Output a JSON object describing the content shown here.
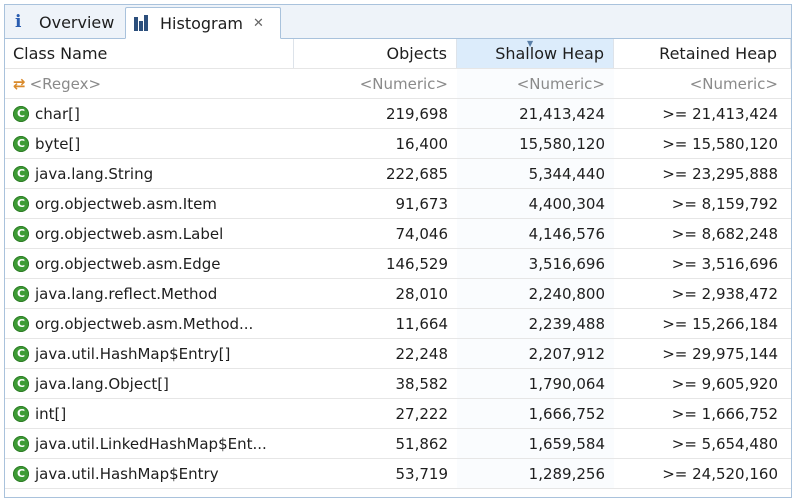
{
  "tabs": [
    {
      "label": "Overview",
      "icon": "info-icon"
    },
    {
      "label": "Histogram",
      "icon": "histogram-icon",
      "active": true
    }
  ],
  "columns": [
    "Class Name",
    "Objects",
    "Shallow Heap",
    "Retained Heap"
  ],
  "filters": {
    "class_name": "<Regex>",
    "objects": "<Numeric>",
    "shallow": "<Numeric>",
    "retained": "<Numeric>"
  },
  "rows": [
    {
      "name": "char[]",
      "objects": "219,698",
      "shallow": "21,413,424",
      "retained": ">= 21,413,424"
    },
    {
      "name": "byte[]",
      "objects": "16,400",
      "shallow": "15,580,120",
      "retained": ">= 15,580,120"
    },
    {
      "name": "java.lang.String",
      "objects": "222,685",
      "shallow": "5,344,440",
      "retained": ">= 23,295,888"
    },
    {
      "name": "org.objectweb.asm.Item",
      "objects": "91,673",
      "shallow": "4,400,304",
      "retained": ">= 8,159,792"
    },
    {
      "name": "org.objectweb.asm.Label",
      "objects": "74,046",
      "shallow": "4,146,576",
      "retained": ">= 8,682,248"
    },
    {
      "name": "org.objectweb.asm.Edge",
      "objects": "146,529",
      "shallow": "3,516,696",
      "retained": ">= 3,516,696"
    },
    {
      "name": "java.lang.reflect.Method",
      "objects": "28,010",
      "shallow": "2,240,800",
      "retained": ">= 2,938,472"
    },
    {
      "name": "org.objectweb.asm.Method...",
      "objects": "11,664",
      "shallow": "2,239,488",
      "retained": ">= 15,266,184"
    },
    {
      "name": "java.util.HashMap$Entry[]",
      "objects": "22,248",
      "shallow": "2,207,912",
      "retained": ">= 29,975,144"
    },
    {
      "name": "java.lang.Object[]",
      "objects": "38,582",
      "shallow": "1,790,064",
      "retained": ">= 9,605,920"
    },
    {
      "name": "int[]",
      "objects": "27,222",
      "shallow": "1,666,752",
      "retained": ">= 1,666,752"
    },
    {
      "name": "java.util.LinkedHashMap$Ent...",
      "objects": "51,862",
      "shallow": "1,659,584",
      "retained": ">= 5,654,480"
    },
    {
      "name": "java.util.HashMap$Entry",
      "objects": "53,719",
      "shallow": "1,289,256",
      "retained": ">= 24,520,160"
    }
  ],
  "colors": {
    "class_icon": "#3d9b35",
    "sorted_header": "#dcecfb",
    "accent": "#2a5db0"
  }
}
